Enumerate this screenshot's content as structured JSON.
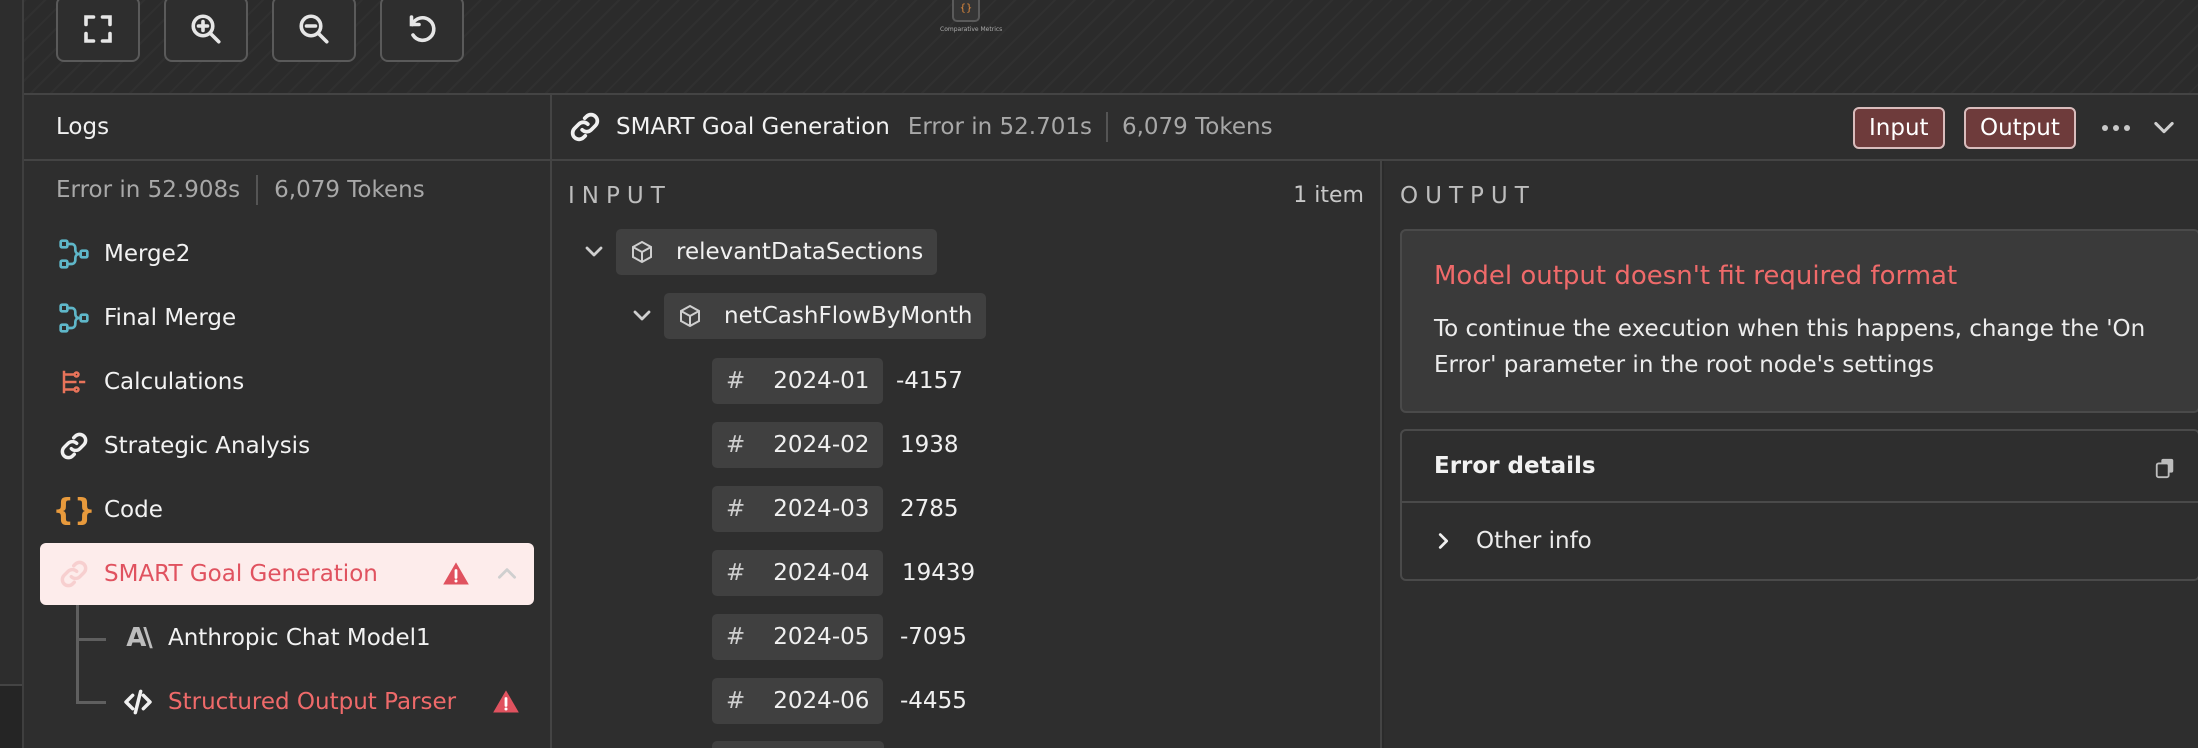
{
  "logs": {
    "title": "Logs",
    "status": "Error in 52.908s",
    "tokens": "6,079 Tokens",
    "items": [
      {
        "label": "Merge2",
        "icon": "merge-icon"
      },
      {
        "label": "Final Merge",
        "icon": "merge-icon"
      },
      {
        "label": "Calculations",
        "icon": "calculations-icon"
      },
      {
        "label": "Strategic Analysis",
        "icon": "link-icon"
      },
      {
        "label": "Code",
        "icon": "code-braces-icon"
      },
      {
        "label": "SMART Goal Generation",
        "icon": "link-icon"
      },
      {
        "label": "Anthropic Chat Model1",
        "icon": "anthropic-icon"
      },
      {
        "label": "Structured Output Parser",
        "icon": "code-tag-icon"
      }
    ]
  },
  "canvas": {
    "mini_node_label": "Comparative Metrics",
    "mini_node_glyph": "{}"
  },
  "detail": {
    "title": "SMART Goal Generation",
    "status": "Error in 52.701s",
    "tokens": "6,079 Tokens",
    "input_button": "Input",
    "output_button": "Output"
  },
  "input": {
    "label": "INPUT",
    "count": "1 item",
    "root_key": "relevantDataSections",
    "child_key": "netCashFlowByMonth",
    "hash": "#",
    "rows": [
      {
        "key": "2024-01",
        "value": "-4157"
      },
      {
        "key": "2024-02",
        "value": "1938"
      },
      {
        "key": "2024-03",
        "value": "2785"
      },
      {
        "key": "2024-04",
        "value": "19439"
      },
      {
        "key": "2024-05",
        "value": "-7095"
      },
      {
        "key": "2024-06",
        "value": "-4455"
      }
    ]
  },
  "output": {
    "label": "OUTPUT",
    "error_title": "Model output doesn't fit required format",
    "error_message": "To continue the execution when this happens, change the 'On Error' parameter in the root node's settings",
    "details_title": "Error details",
    "other_info": "Other info"
  },
  "colors": {
    "error": "#ef6a6a",
    "selected_bg": "#fdeceb",
    "pill_bg": "#6e3b3b",
    "merge_icon": "#5fb7c9",
    "calc_icon": "#e8735a",
    "code_icon": "#e89a3c"
  }
}
